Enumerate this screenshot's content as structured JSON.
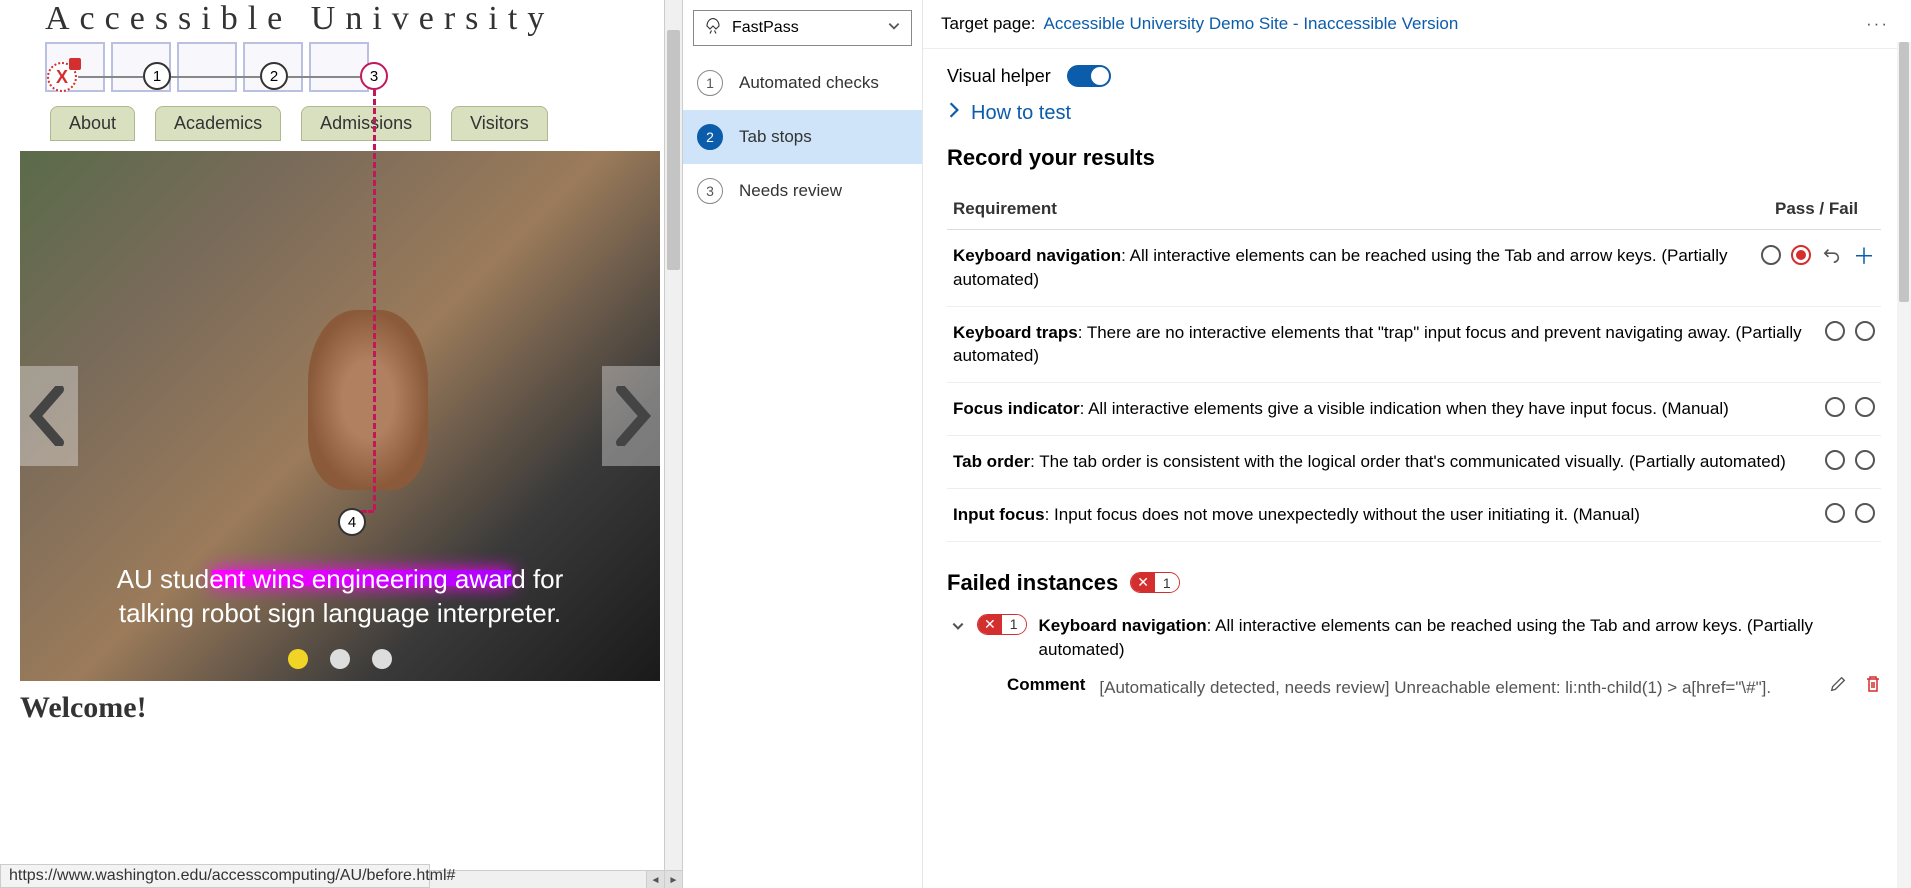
{
  "left": {
    "title": "Accessible University",
    "nav": [
      "About",
      "Academics",
      "Admissions",
      "Visitors"
    ],
    "carousel_caption": "AU student wins engineering award for talking robot sign language interpreter.",
    "welcome": "Welcome!",
    "status_url": "https://www.washington.edu/accesscomputing/AU/before.html#",
    "tab_stops": {
      "x": "X",
      "n1": "1",
      "n2": "2",
      "n3": "3",
      "n4": "4"
    }
  },
  "panel": {
    "dropdown": "FastPass",
    "steps": [
      {
        "num": "1",
        "label": "Automated checks"
      },
      {
        "num": "2",
        "label": "Tab stops"
      },
      {
        "num": "3",
        "label": "Needs review"
      }
    ],
    "target_label": "Target page:",
    "target_link": "Accessible University Demo Site - Inaccessible Version",
    "visual_helper": "Visual helper",
    "how_to_test": "How to test",
    "record_title": "Record your results",
    "req_col": "Requirement",
    "pf_col": "Pass / Fail",
    "requirements": [
      {
        "name": "Keyboard navigation",
        "desc": ": All interactive elements can be reached using the Tab and arrow keys. (Partially automated)",
        "fail": true,
        "extras": true
      },
      {
        "name": "Keyboard traps",
        "desc": ": There are no interactive elements that \"trap\" input focus and prevent navigating away. (Partially automated)",
        "fail": false,
        "extras": false
      },
      {
        "name": "Focus indicator",
        "desc": ": All interactive elements give a visible indication when they have input focus. (Manual)",
        "fail": false,
        "extras": false
      },
      {
        "name": "Tab order",
        "desc": ": The tab order is consistent with the logical order that's communicated visually. (Partially automated)",
        "fail": false,
        "extras": false
      },
      {
        "name": "Input focus",
        "desc": ": Input focus does not move unexpectedly without the user initiating it. (Manual)",
        "fail": false,
        "extras": false
      }
    ],
    "failed_title": "Failed instances",
    "failed_badge": "1",
    "failed_item": {
      "name": "Keyboard navigation",
      "desc": ": All interactive elements can be reached using the Tab and arrow keys. (Partially automated)",
      "badge": "1"
    },
    "comment_label": "Comment",
    "comment_text": "[Automatically detected, needs review] Unreachable element: li:nth-child(1) > a[href=\"\\#\"]."
  }
}
